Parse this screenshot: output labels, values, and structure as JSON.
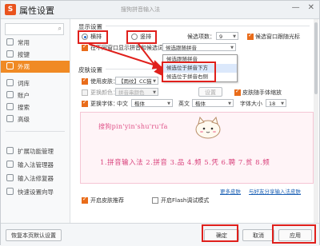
{
  "window": {
    "title": "属性设置",
    "subtitle": "搜狗拼音输入法",
    "app_icon": "S",
    "minimize": "—",
    "close": "✕"
  },
  "sidebar": {
    "search_icon": "⌕",
    "items": [
      {
        "label": "常用",
        "active": false
      },
      {
        "label": "按键",
        "active": false
      },
      {
        "label": "外观",
        "active": true
      },
      {
        "label": "词库",
        "active": false
      },
      {
        "label": "账户",
        "active": false
      },
      {
        "label": "搜索",
        "active": false
      },
      {
        "label": "高级",
        "active": false
      }
    ],
    "tools": [
      {
        "label": "扩展功能管理"
      },
      {
        "label": "输入法管理器"
      },
      {
        "label": "输入法修复器"
      },
      {
        "label": "快速设置向导"
      }
    ]
  },
  "display": {
    "section_title": "显示设置",
    "horizontal_label": "横排",
    "vertical_label": "竖排",
    "candidates_label": "候选项数：",
    "candidates_value": "9",
    "cursor_follow_label": "候选窗口跟随光标",
    "show_pinyin_label": "在不同窗口显示拼音和候选词",
    "position_select": "候选跟随拼音",
    "dropdown_options": [
      "候选跟随拼音",
      "候选位于拼音下方",
      "候选位于拼音右侧"
    ]
  },
  "skin": {
    "section_title": "皮肤设置",
    "use_skin_label": "使用皮肤：",
    "skin_value": "【雨纹】CC猫",
    "change_color_label": "更换颜色：",
    "color_value": "拼音串颜色",
    "setting_btn": "设置",
    "follow_system_label": "皮肤随手体缩放",
    "change_font_label": "更换字体：",
    "chinese_label": "中文",
    "chinese_font": "楷体",
    "english_label": "英文",
    "english_font": "楷体",
    "font_size_label": "字体大小",
    "font_size": "18",
    "preview_pinyin": "搜狗pin'yin'shu'ru'fa",
    "preview_candidates": "1.拼音输入法  2.拼音  3.品  4.频  5.凭  6.聘  7.贫  8.频"
  },
  "options": {
    "recommend_label": "开启皮肤推荐",
    "flash_label": "开启Flash调试模式",
    "more_skins_link": "更多皮肤",
    "share_link": "与好友分享输入法皮肤"
  },
  "footer": {
    "restore_label": "恢复本页默认设置",
    "ok_label": "确定",
    "cancel_label": "取消",
    "apply_label": "应用"
  },
  "colors": {
    "accent": "#f08a24",
    "highlight_box": "#e0201c",
    "preview_text": "#e0548a"
  }
}
